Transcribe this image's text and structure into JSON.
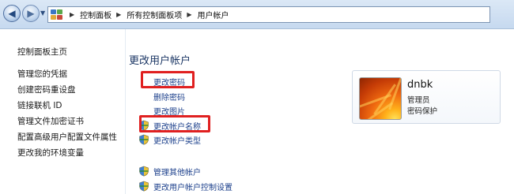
{
  "address_bar": {
    "breadcrumbs": [
      "控制面板",
      "所有控制面板项",
      "用户帐户"
    ]
  },
  "left_nav": {
    "items": [
      "控制面板主页",
      "管理您的凭据",
      "创建密码重设盘",
      "链接联机 ID",
      "管理文件加密证书",
      "配置高级用户配置文件属性",
      "更改我的环境变量"
    ]
  },
  "main": {
    "title": "更改用户帐户",
    "tasks": [
      "更改密码",
      "删除密码",
      "更改图片",
      "更改帐户名称",
      "更改帐户类型"
    ],
    "other_tasks": [
      "管理其他帐户",
      "更改用户帐户控制设置"
    ]
  },
  "account": {
    "name": "dnbk",
    "role": "管理员",
    "status": "密码保护"
  },
  "colors": {
    "highlight": "#e02020",
    "link": "#1b3f8b",
    "title": "#1b3664"
  },
  "icons": {
    "back": "back-arrow-icon",
    "forward": "forward-arrow-icon",
    "control_panel": "control-panel-icon",
    "uac": "uac-shield-icon"
  }
}
